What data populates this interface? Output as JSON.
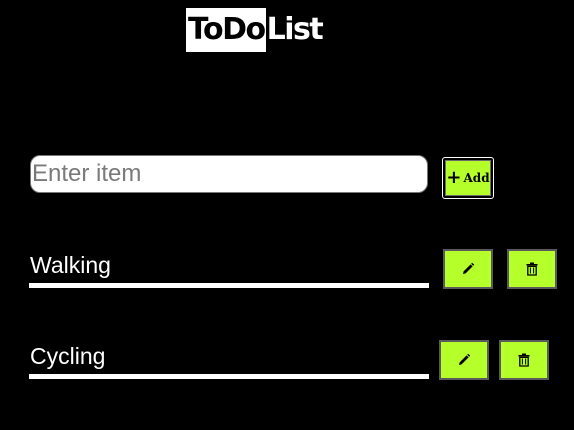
{
  "header": {
    "title_highlight": "ToDo",
    "title_rest": "List"
  },
  "input": {
    "placeholder": "Enter item",
    "value": ""
  },
  "add_button": {
    "icon": "plus-icon",
    "label": "Add"
  },
  "items": [
    {
      "text": "Walking",
      "edit_icon": "pencil-icon",
      "delete_icon": "trash-icon"
    },
    {
      "text": "Cycling",
      "edit_icon": "pencil-icon",
      "delete_icon": "trash-icon"
    }
  ],
  "colors": {
    "background": "#000000",
    "button_fill": "#b5ff2b",
    "text": "#ffffff"
  }
}
